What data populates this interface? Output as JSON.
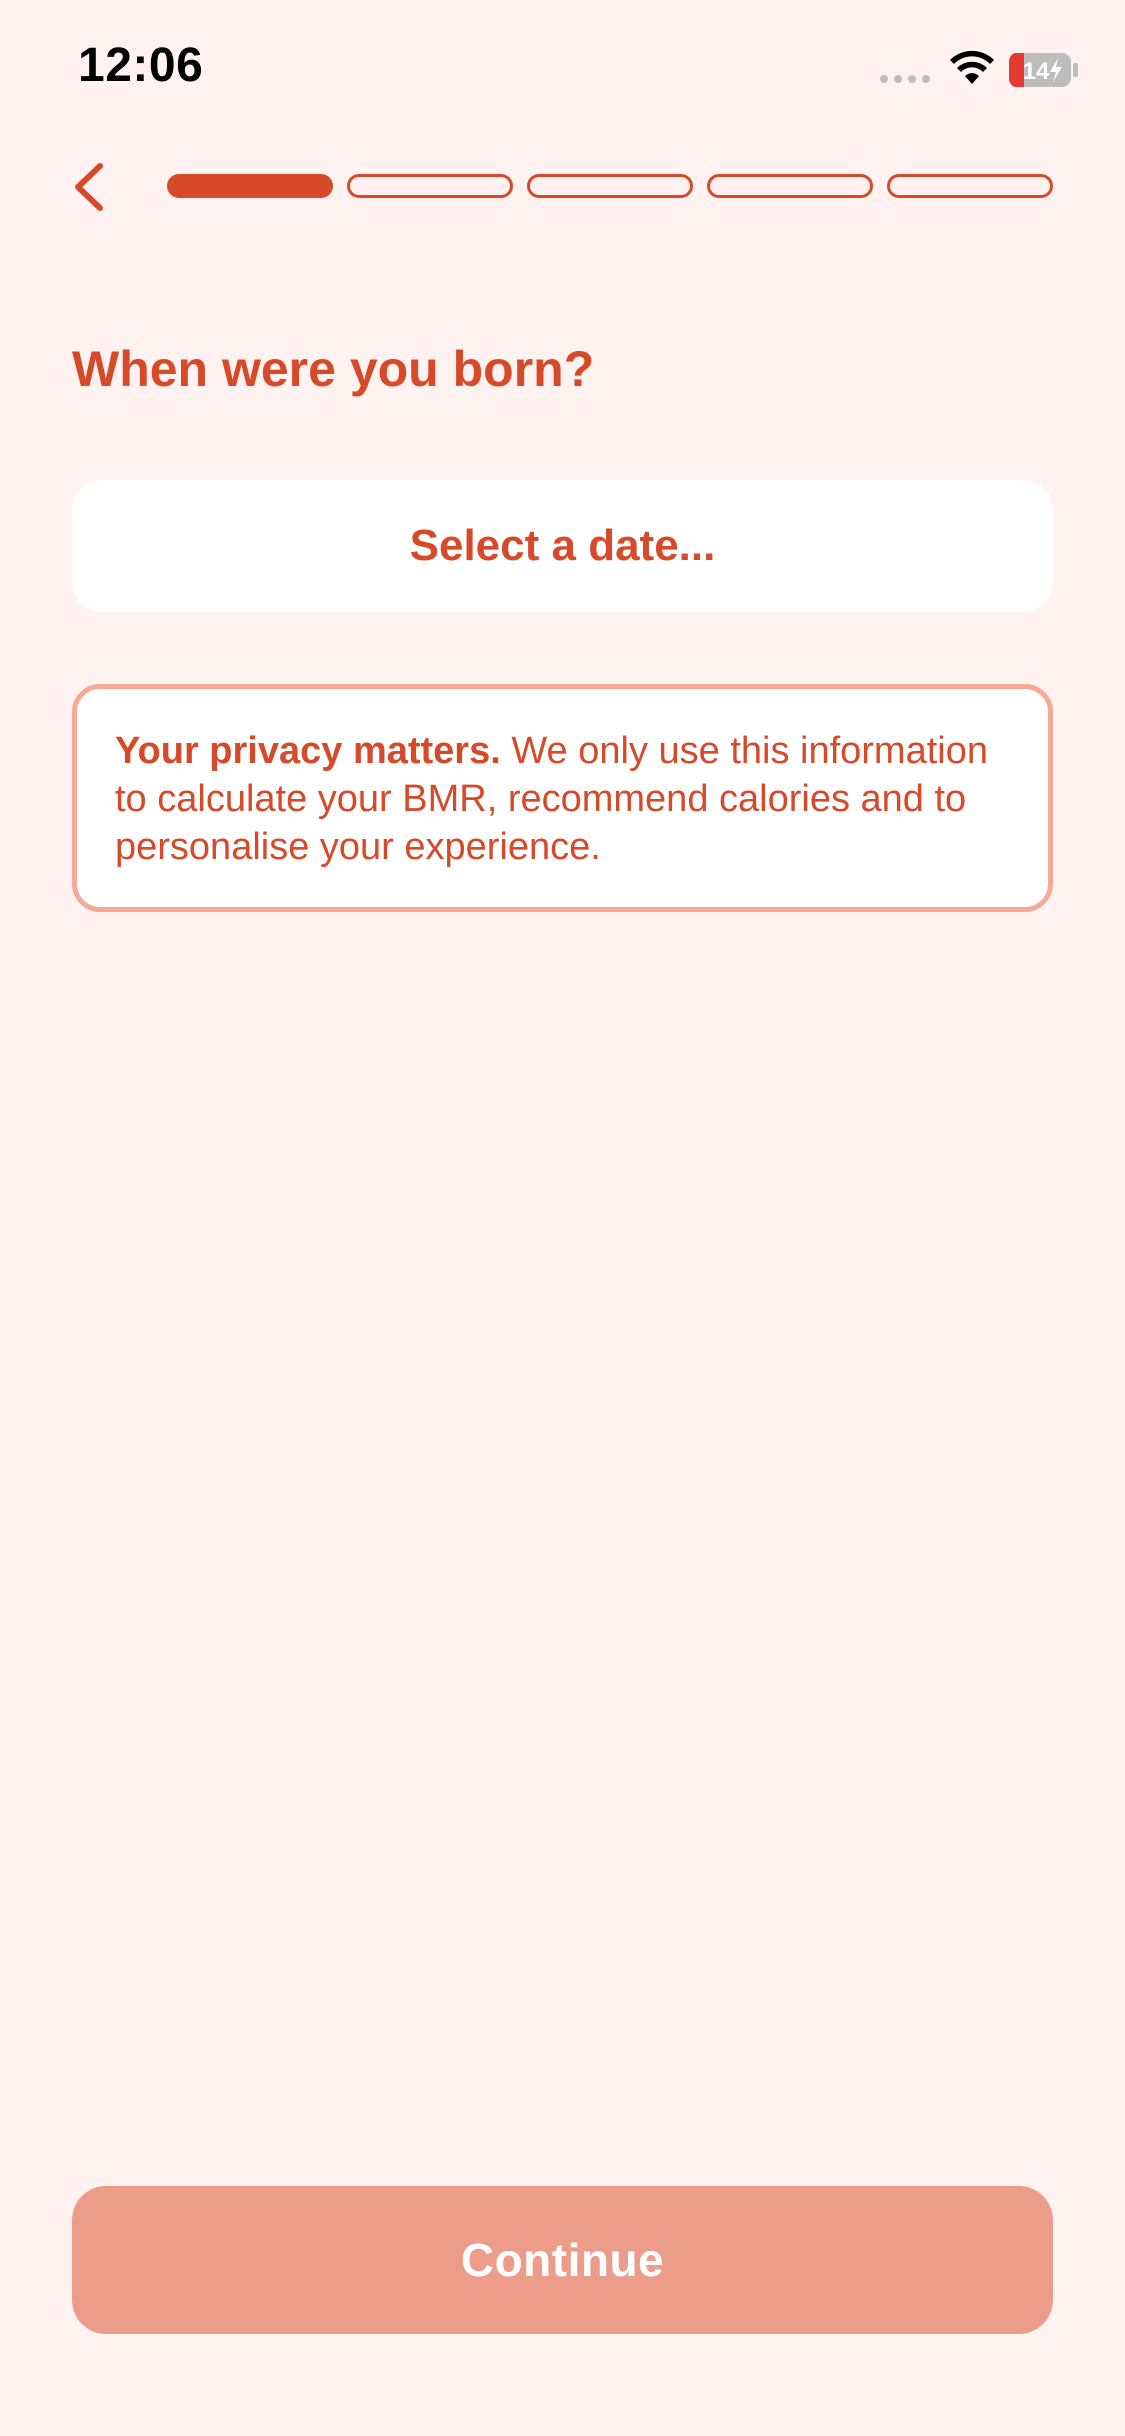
{
  "status_bar": {
    "time": "12:06",
    "battery_level": "14",
    "icons": [
      "cellular-signal-icon",
      "wifi-icon",
      "battery-charging-icon"
    ]
  },
  "header": {
    "back_icon": "chevron-left-icon",
    "progress": {
      "total_steps": 5,
      "current_step": 1
    }
  },
  "main": {
    "question": "When were you born?",
    "date_placeholder": "Select a date...",
    "privacy": {
      "bold_text": "Your privacy matters.",
      "body_text": " We only use this information to calculate your BMR, recommend calories and to personalise your experience."
    }
  },
  "footer": {
    "continue_label": "Continue"
  },
  "colors": {
    "accent": "#D64A2A",
    "background": "#FFF2F0",
    "card": "#FFFFFF",
    "privacy_border": "#F6A996",
    "continue_disabled": "#EC9D8A"
  }
}
